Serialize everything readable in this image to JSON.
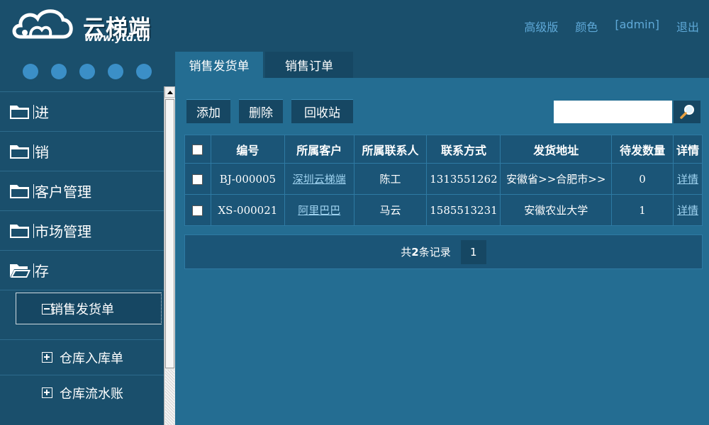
{
  "brand": {
    "logo_text": "云梯端",
    "logo_url": "www.ytd.cn"
  },
  "topnav": {
    "items": [
      "高级版",
      "颜色",
      "[admin]",
      "退出"
    ]
  },
  "sidebar": {
    "nav_items": [
      {
        "label": "进"
      },
      {
        "label": "销"
      },
      {
        "label": "客户管理"
      },
      {
        "label": "市场管理"
      },
      {
        "label": "存"
      }
    ],
    "selected_sub": "销售发货单",
    "sub_items": [
      "仓库入库单",
      "仓库流水账"
    ]
  },
  "tabs": [
    {
      "label": "销售发货单",
      "active": true
    },
    {
      "label": "销售订单",
      "active": false
    }
  ],
  "toolbar": {
    "add_label": "添加",
    "delete_label": "删除",
    "recycle_label": "回收站",
    "search_placeholder": ""
  },
  "table": {
    "headers": [
      "",
      "编号",
      "所属客户",
      "所属联系人",
      "联系方式",
      "发货地址",
      "待发数量",
      "详情"
    ],
    "rows": [
      {
        "id": "BJ-000005",
        "customer": "深圳云梯端",
        "contact": "陈工",
        "phone": "1313551262",
        "address": "安徽省>>合肥市>>",
        "qty": "0",
        "detail": "详情"
      },
      {
        "id": "XS-000021",
        "customer": "阿里巴巴",
        "contact": "马云",
        "phone": "1585513231",
        "address": "安徽农业大学",
        "qty": "1",
        "detail": "详情"
      }
    ]
  },
  "pager": {
    "info_prefix": "共",
    "info_count": "2",
    "info_suffix": "条记录",
    "current_page": "1"
  },
  "colors": {
    "background": "#246d92",
    "sidebar": "#1a4f6c",
    "button": "#164763",
    "link": "#5fa9d8"
  }
}
